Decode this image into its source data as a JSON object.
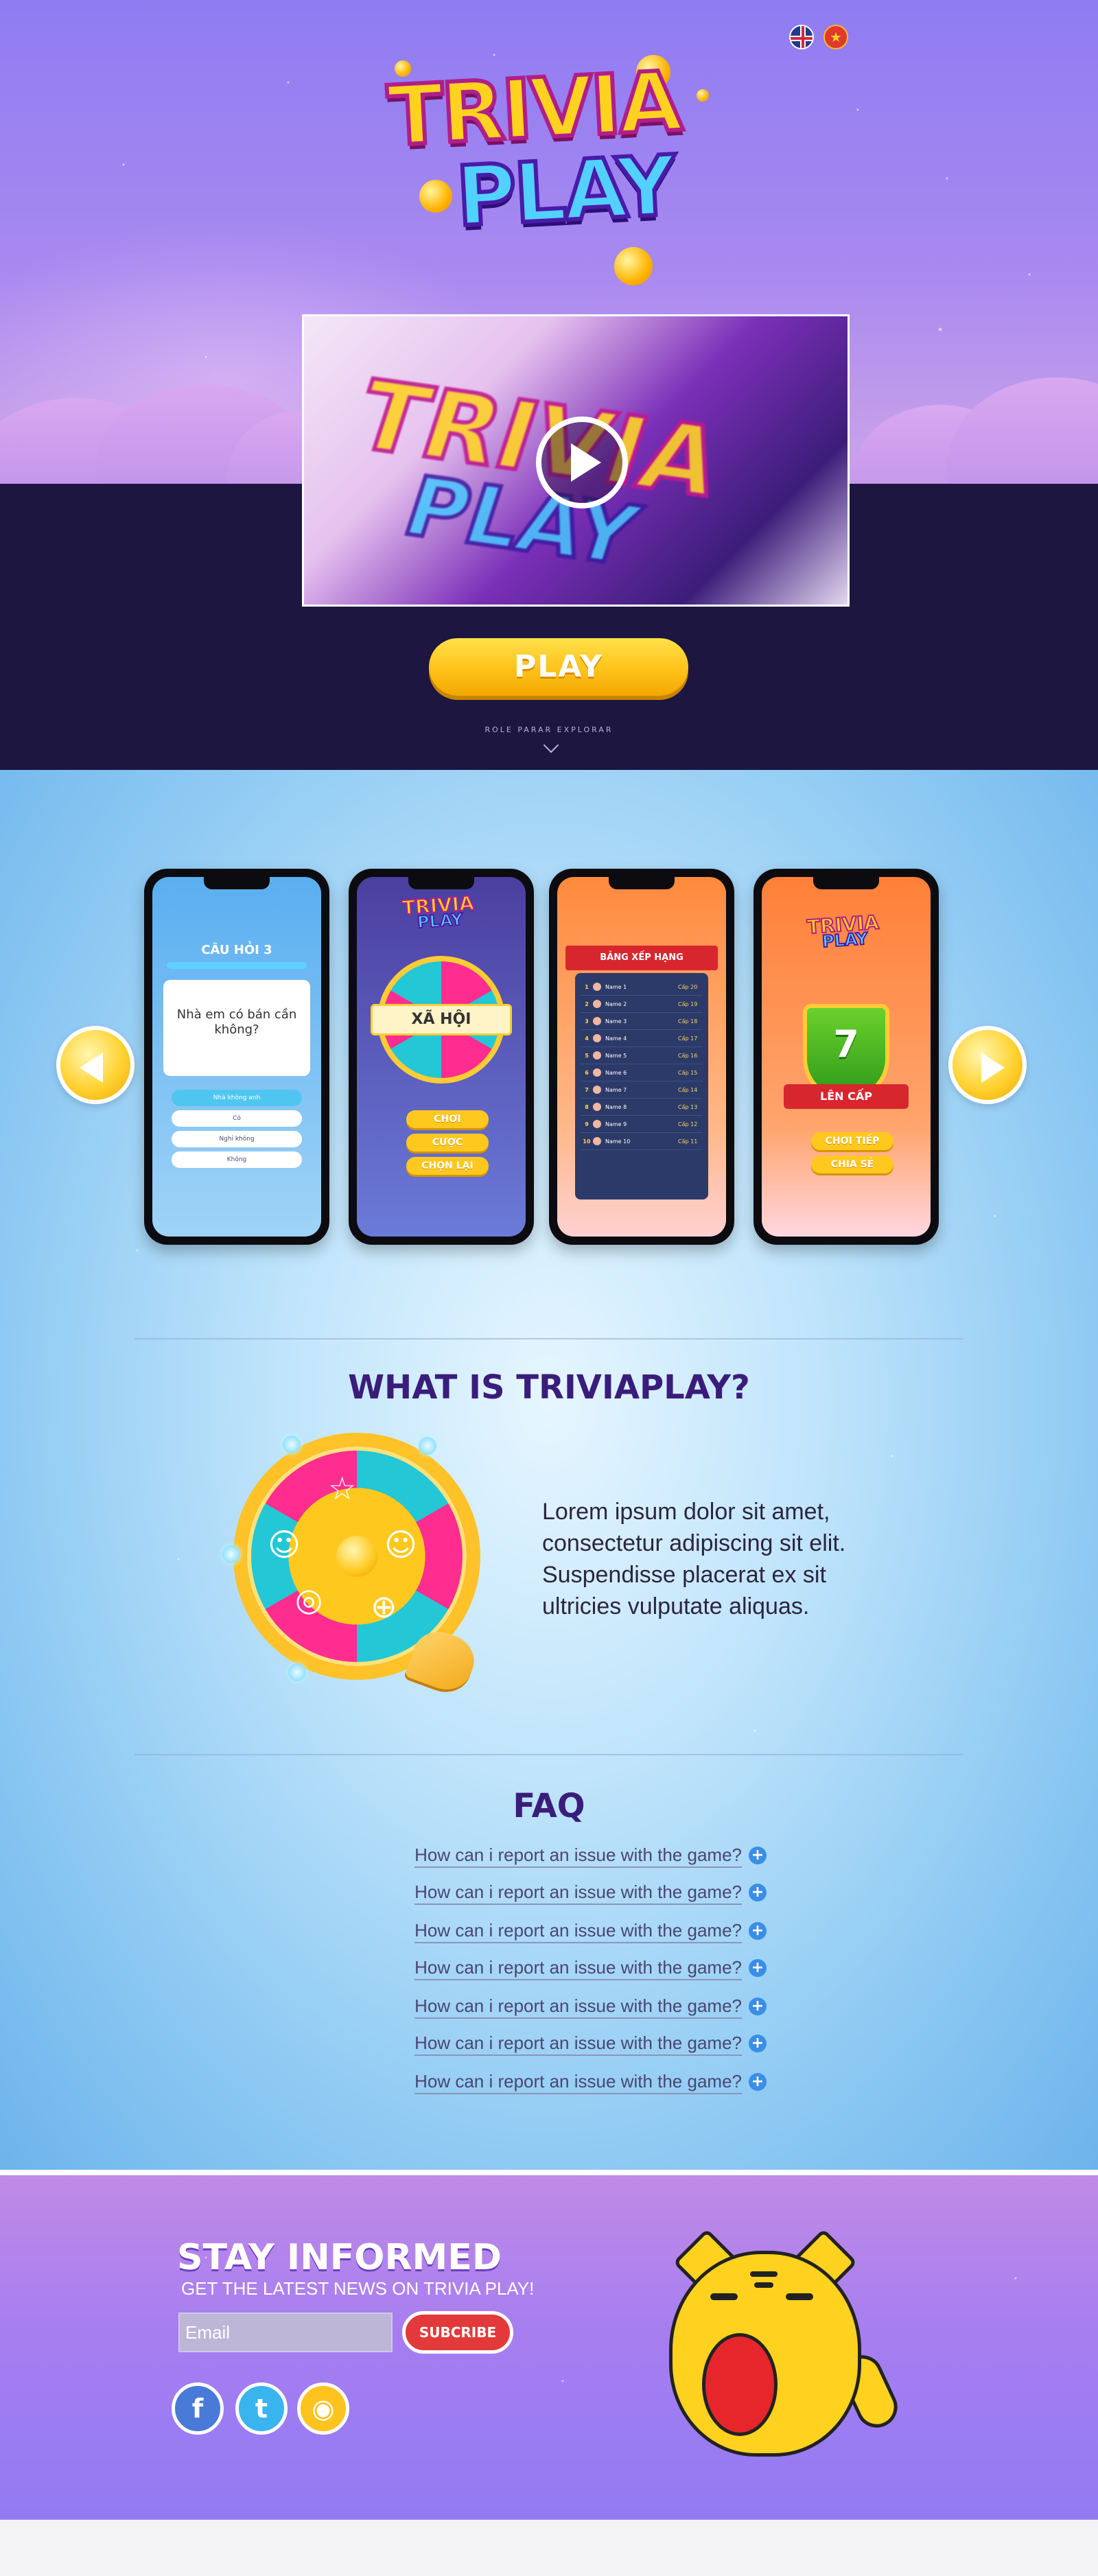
{
  "header": {
    "languages": [
      {
        "icon": "uk-flag-icon"
      },
      {
        "icon": "vietnam-flag-icon",
        "glyph": "★"
      }
    ],
    "logo": {
      "line1": "TRIVIA",
      "line2": "PLAY"
    },
    "video": {
      "title_line1": "TRIVIA",
      "title_line2": "PLAY",
      "icon": "play-icon"
    },
    "play_button": "PLAY",
    "explore_text": "ROLE PARAR EXPLORAR",
    "explore_icon": "chevron-down-icon"
  },
  "carousel": {
    "prev_icon": "arrow-left-icon",
    "next_icon": "arrow-right-icon",
    "screens": [
      {
        "title": "CÂU HỎI 3",
        "question": "Nhà em có bán cần không?",
        "answers": [
          "Nhà không anh",
          "Có",
          "Nghỉ không",
          "Không"
        ]
      },
      {
        "logo_line1": "TRIVIA",
        "logo_line2": "PLAY",
        "category": "XÃ HỘI",
        "buttons": [
          "CHƠI",
          "CƯỢC",
          "CHỌN LẠI"
        ]
      },
      {
        "banner": "BẢNG XẾP HẠNG",
        "rows": [
          {
            "rank": "1",
            "name": "Name 1",
            "level": "Cấp 20"
          },
          {
            "rank": "2",
            "name": "Name 2",
            "level": "Cấp 19"
          },
          {
            "rank": "3",
            "name": "Name 3",
            "level": "Cấp 18"
          },
          {
            "rank": "4",
            "name": "Name 4",
            "level": "Cấp 17"
          },
          {
            "rank": "5",
            "name": "Name 5",
            "level": "Cấp 16"
          },
          {
            "rank": "6",
            "name": "Name 6",
            "level": "Cấp 15"
          },
          {
            "rank": "7",
            "name": "Name 7",
            "level": "Cấp 14"
          },
          {
            "rank": "8",
            "name": "Name 8",
            "level": "Cấp 13"
          },
          {
            "rank": "9",
            "name": "Name 9",
            "level": "Cấp 12"
          },
          {
            "rank": "10",
            "name": "Name 10",
            "level": "Cấp 11"
          }
        ]
      },
      {
        "logo_line1": "TRIVIA",
        "logo_line2": "PLAY",
        "level": "7",
        "banner": "LÊN CẤP",
        "buttons": [
          "CHƠI TIẾP",
          "CHIA SẺ"
        ]
      }
    ]
  },
  "about": {
    "title": "WHAT IS TRIVIAPLAY?",
    "text": "Lorem ipsum dolor sit amet, consectetur adipiscing sit elit. Suspendisse placerat ex sit ultricies vulputate aliquas.",
    "wheel_icons": [
      "star-icon",
      "smiley-icon",
      "football-icon",
      "globe-icon",
      "smiley-icon",
      "camera-icon"
    ]
  },
  "faq": {
    "title": "FAQ",
    "items": [
      "How can i report an issue with the game?",
      "How can i report an issue with the game?",
      "How can i report an issue with the game?",
      "How can i report an issue with the game?",
      "How can i report an issue with the game?",
      "How can i report an issue with the game?",
      "How can i report an issue with the game?"
    ],
    "expand_icon": "plus-circle-icon",
    "expand_glyph": "+"
  },
  "footer": {
    "title": "STAY INFORMED",
    "subtitle": "GET THE LATEST NEWS ON TRIVIA PLAY!",
    "email_placeholder": "Email",
    "subscribe": "SUBCRIBE",
    "social": [
      {
        "icon": "facebook-icon",
        "glyph": "f"
      },
      {
        "icon": "twitter-icon",
        "glyph": "t"
      },
      {
        "icon": "gamepad-icon",
        "glyph": "◉"
      }
    ],
    "mascot": "tiger-mascot"
  }
}
